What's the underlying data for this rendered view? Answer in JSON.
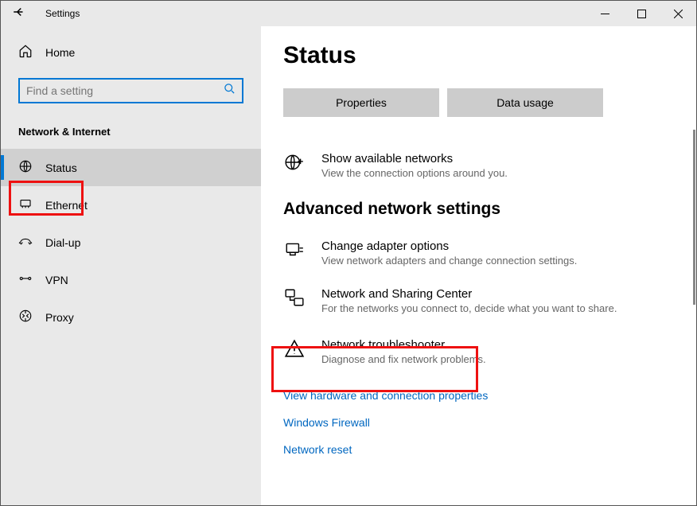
{
  "titlebar": {
    "title": "Settings"
  },
  "sidebar": {
    "home_label": "Home",
    "search_placeholder": "Find a setting",
    "section_label": "Network & Internet",
    "items": [
      {
        "label": "Status",
        "selected": true,
        "icon": "globe"
      },
      {
        "label": "Ethernet",
        "selected": false,
        "icon": "ethernet"
      },
      {
        "label": "Dial-up",
        "selected": false,
        "icon": "phone"
      },
      {
        "label": "VPN",
        "selected": false,
        "icon": "vpn"
      },
      {
        "label": "Proxy",
        "selected": false,
        "icon": "proxy"
      }
    ]
  },
  "main": {
    "title": "Status",
    "buttons": {
      "properties": "Properties",
      "data_usage": "Data usage"
    },
    "show_networks": {
      "title": "Show available networks",
      "sub": "View the connection options around you."
    },
    "advanced_heading": "Advanced network settings",
    "adapter": {
      "title": "Change adapter options",
      "sub": "View network adapters and change connection settings."
    },
    "sharing": {
      "title": "Network and Sharing Center",
      "sub": "For the networks you connect to, decide what you want to share."
    },
    "troubleshooter": {
      "title": "Network troubleshooter",
      "sub": "Diagnose and fix network problems."
    },
    "links": {
      "hardware": "View hardware and connection properties",
      "firewall": "Windows Firewall",
      "reset": "Network reset"
    }
  }
}
